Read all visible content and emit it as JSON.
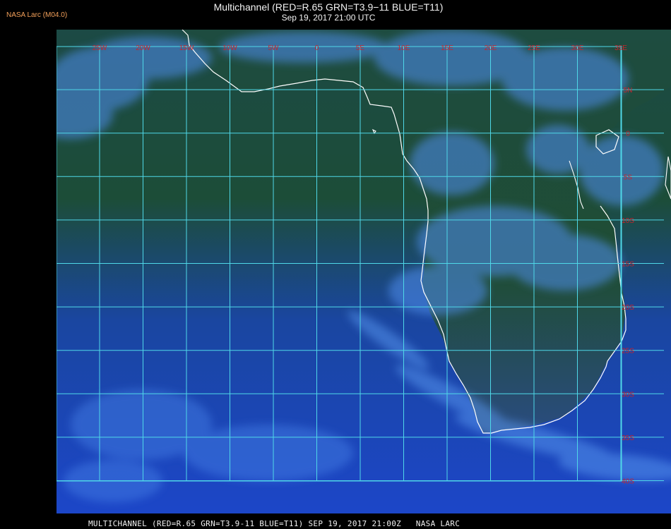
{
  "header": {
    "credit": "NASA Larc (M04.0)",
    "title": "Multichannel (RED=R.65 GRN=T3.9−11 BLUE=T11)",
    "subtitle": "Sep 19, 2017 21:00 UTC"
  },
  "map": {
    "lon_labels": [
      "25W",
      "20W",
      "15W",
      "10W",
      "5W",
      "0",
      "5E",
      "10E",
      "15E",
      "20E",
      "25E",
      "30E",
      "35E"
    ],
    "lat_labels": [
      "5N",
      "0",
      "5S",
      "10S",
      "15S",
      "20S",
      "25S",
      "30S",
      "35S",
      "40S"
    ],
    "colors": {
      "grid": "#4fd8e8",
      "label": "#c8242c",
      "coast": "#ffffff",
      "ocean": "#1a3fa8",
      "land": "#1d4a22",
      "cloud": "#4f8ef0"
    }
  },
  "footer": {
    "caption": "MULTICHANNEL (RED=R.65 GRN=T3.9-11 BLUE=T11) SEP 19, 2017 21:00Z   NASA LARC"
  }
}
